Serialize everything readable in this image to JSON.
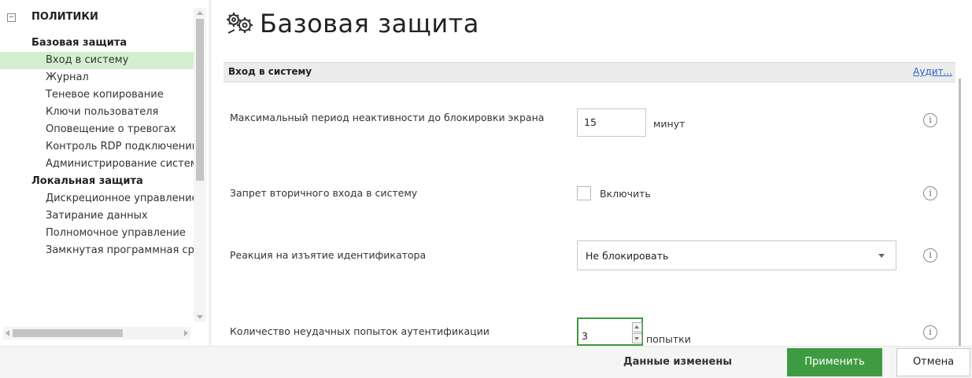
{
  "tree": {
    "root_label": "ПОЛИТИКИ",
    "items": [
      {
        "label": "Базовая защита",
        "type": "group"
      },
      {
        "label": "Вход в систему",
        "type": "child",
        "selected": true
      },
      {
        "label": "Журнал",
        "type": "child"
      },
      {
        "label": "Теневое копирование",
        "type": "child"
      },
      {
        "label": "Ключи пользователя",
        "type": "child"
      },
      {
        "label": "Оповещение о тревогах",
        "type": "child"
      },
      {
        "label": "Контроль RDP подключений",
        "type": "child"
      },
      {
        "label": "Администрирование системы",
        "type": "child"
      },
      {
        "label": "Локальная защита",
        "type": "group"
      },
      {
        "label": "Дискреционное управление",
        "type": "child"
      },
      {
        "label": "Затирание данных",
        "type": "child"
      },
      {
        "label": "Полномочное управление",
        "type": "child"
      },
      {
        "label": "Замкнутая программная среда",
        "type": "child"
      }
    ]
  },
  "main": {
    "title": "Базовая защита",
    "section_title": "Вход в систему",
    "section_link": "Аудит..."
  },
  "settings": {
    "inactivity": {
      "label": "Максимальный период неактивности до блокировки экрана",
      "value": "15",
      "unit": "минут"
    },
    "secondary_login": {
      "label": "Запрет вторичного входа в систему",
      "checkbox_label": "Включить",
      "checked": false
    },
    "token_removal": {
      "label": "Реакция на изъятие идентификатора",
      "selected": "Не блокировать"
    },
    "failed_attempts": {
      "label": "Количество неудачных попыток аутентификации",
      "value": "3",
      "unit": "попытки"
    },
    "info_symbol": "i"
  },
  "footer": {
    "status": "Данные изменены",
    "apply_label": "Применить",
    "cancel_label": "Отмена"
  },
  "colors": {
    "accent_green": "#3f9b41",
    "selected_bg": "#d4efcf",
    "link_blue": "#2a62c9"
  }
}
